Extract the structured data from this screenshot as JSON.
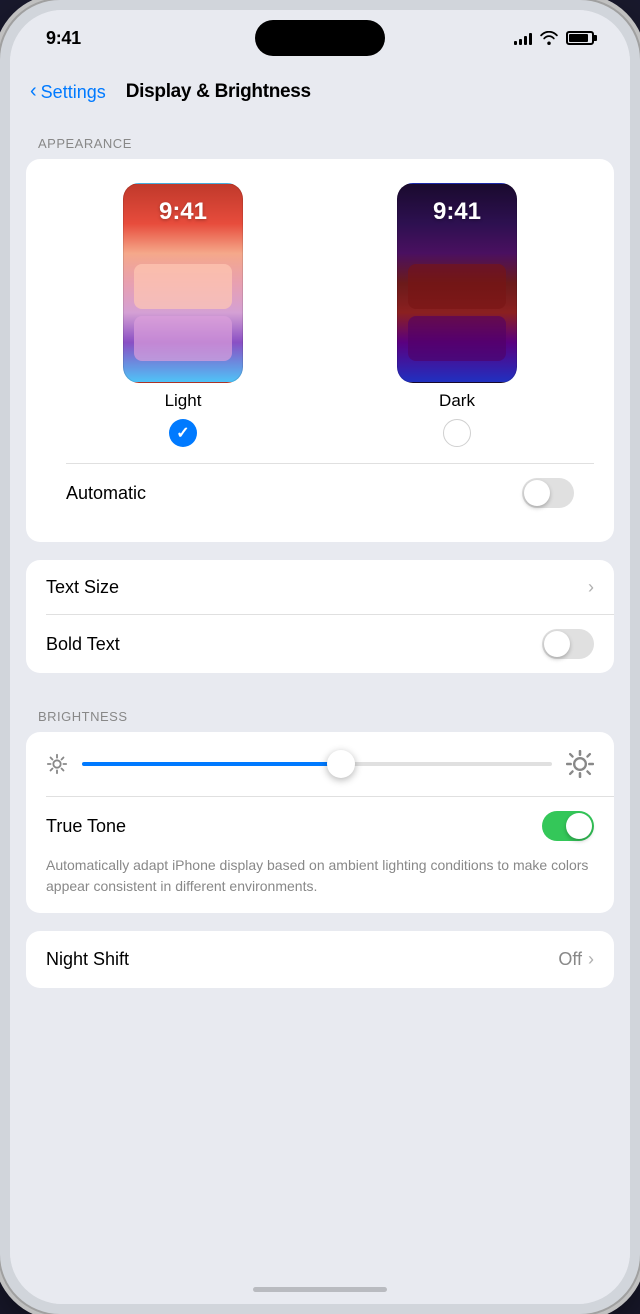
{
  "status": {
    "time": "9:41",
    "signal_bars": [
      4,
      6,
      8,
      11,
      14
    ],
    "battery_level": 85
  },
  "nav": {
    "back_label": "Settings",
    "title": "Display & Brightness"
  },
  "appearance": {
    "section_label": "APPEARANCE",
    "light_theme": {
      "label": "Light",
      "time": "9:41",
      "selected": true
    },
    "dark_theme": {
      "label": "Dark",
      "time": "9:41",
      "selected": false
    },
    "automatic": {
      "label": "Automatic",
      "enabled": false
    }
  },
  "text_settings": {
    "text_size": {
      "label": "Text Size"
    },
    "bold_text": {
      "label": "Bold Text",
      "enabled": false
    }
  },
  "brightness": {
    "section_label": "BRIGHTNESS",
    "slider_value": 55,
    "true_tone": {
      "label": "True Tone",
      "enabled": true,
      "description": "Automatically adapt iPhone display based on ambient lighting conditions to make colors appear consistent in different environments."
    }
  },
  "night_shift": {
    "label": "Night Shift",
    "value": "Off",
    "chevron": "›"
  }
}
